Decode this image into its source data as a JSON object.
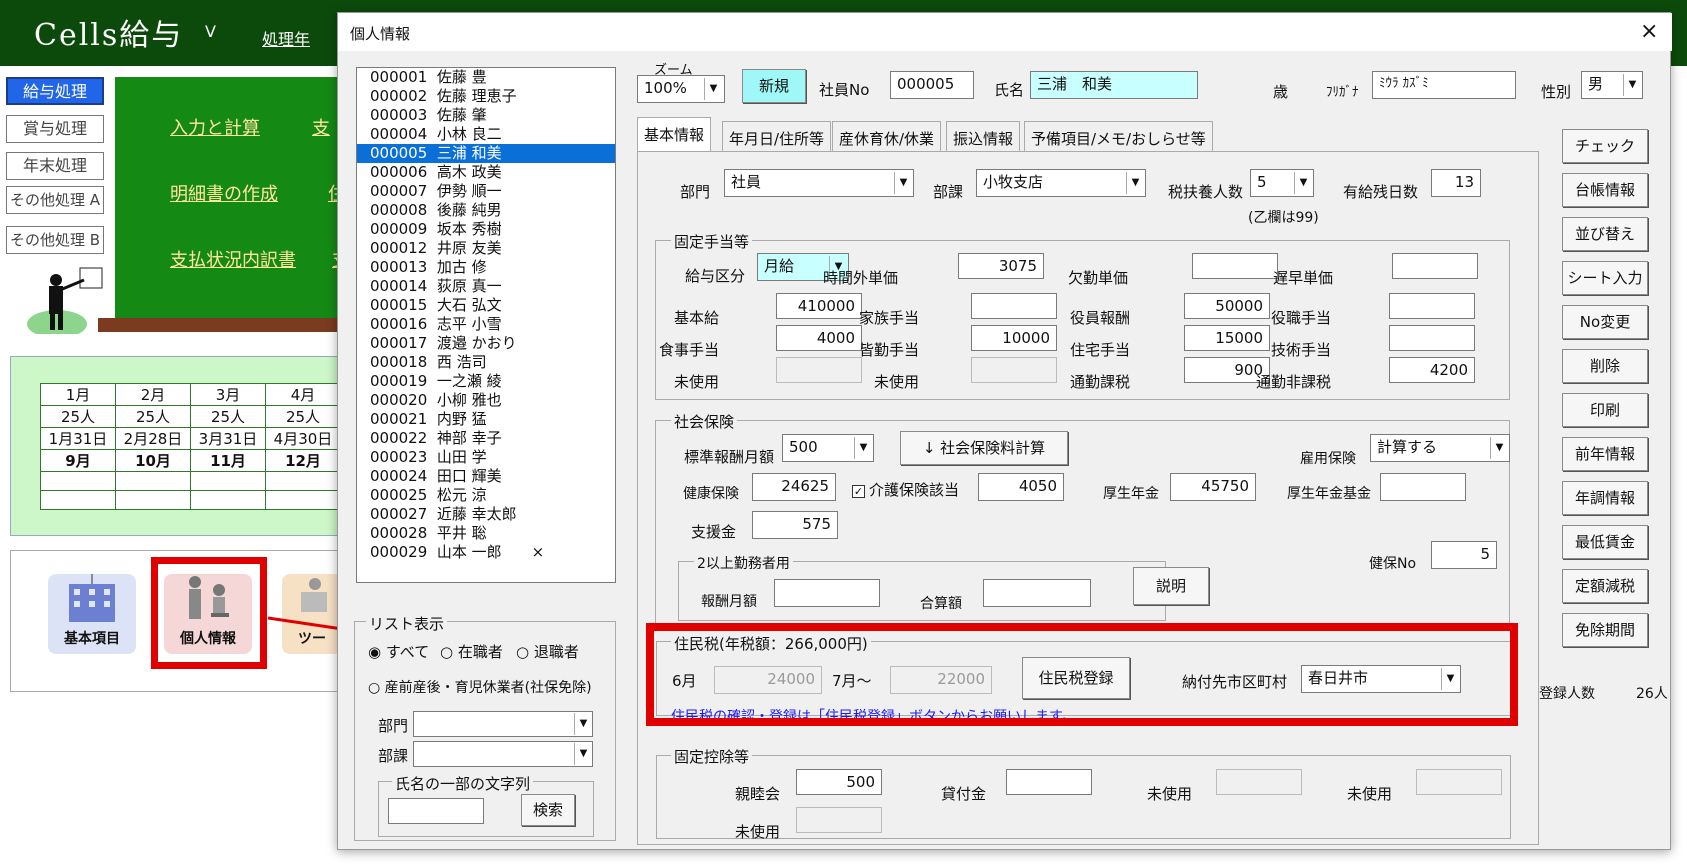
{
  "background": {
    "app_title": "Cells給与",
    "user_initial": "V",
    "processing_year": "処理年",
    "nav": [
      "給与処理",
      "賞与処理",
      "年末処理",
      "その他処理 A",
      "その他処理 B"
    ],
    "links": [
      "入力と計算",
      "明細書の作成",
      "支払状況内訳書",
      "支",
      "住",
      "支"
    ],
    "calendar": {
      "months": [
        "1月",
        "2月",
        "3月",
        "4月"
      ],
      "counts": [
        "25人",
        "25人",
        "25人",
        "25人"
      ],
      "dates": [
        "1月31日",
        "2月28日",
        "3月31日",
        "4月30日"
      ],
      "months2": [
        "9月",
        "10月",
        "11月",
        "12月"
      ]
    },
    "icons": [
      "基本項目",
      "個人情報",
      "ツー"
    ]
  },
  "dialog": {
    "title": "個人情報",
    "close": "×",
    "employees": [
      {
        "no": "000001",
        "name": "佐藤 豊"
      },
      {
        "no": "000002",
        "name": "佐藤 理恵子"
      },
      {
        "no": "000003",
        "name": "佐藤 肇"
      },
      {
        "no": "000004",
        "name": "小林 良二"
      },
      {
        "no": "000005",
        "name": "三浦 和美"
      },
      {
        "no": "000006",
        "name": "高木 政美"
      },
      {
        "no": "000007",
        "name": "伊勢 順一"
      },
      {
        "no": "000008",
        "name": "後藤 純男"
      },
      {
        "no": "000009",
        "name": "坂本 秀樹"
      },
      {
        "no": "000012",
        "name": "井原 友美"
      },
      {
        "no": "000013",
        "name": "加古 修"
      },
      {
        "no": "000014",
        "name": "荻原 真一"
      },
      {
        "no": "000015",
        "name": "大石 弘文"
      },
      {
        "no": "000016",
        "name": "志平 小雪"
      },
      {
        "no": "000017",
        "name": "渡邉 かおり"
      },
      {
        "no": "000018",
        "name": "西 浩司"
      },
      {
        "no": "000019",
        "name": "一之瀬 綾"
      },
      {
        "no": "000020",
        "name": "小柳 雅也"
      },
      {
        "no": "000021",
        "name": "内野 猛"
      },
      {
        "no": "000022",
        "name": "神部 幸子"
      },
      {
        "no": "000023",
        "name": "山田 学"
      },
      {
        "no": "000024",
        "name": "田口 輝美"
      },
      {
        "no": "000025",
        "name": "松元 涼"
      },
      {
        "no": "000027",
        "name": "近藤 幸太郎"
      },
      {
        "no": "000028",
        "name": "平井 聡"
      },
      {
        "no": "000029",
        "name": "山本 一郎"
      }
    ],
    "selected_row": 4,
    "list_mark": "×",
    "list_display": {
      "title": "リスト表示",
      "radio_all": "すべて",
      "radio_active": "在職者",
      "radio_retired": "退職者",
      "radio_leave": "産前産後・育児休業者(社保免除)"
    },
    "filter": {
      "dept_label": "部門",
      "section_label": "部課",
      "name_search_title": "氏名の一部の文字列",
      "search_btn": "検索"
    },
    "header": {
      "zoom_label": "ズーム",
      "zoom": "100%",
      "new_btn": "新規",
      "empno_label": "社員No",
      "empno": "000005",
      "name_label": "氏名",
      "name": "三浦　和美",
      "age_label": "歳",
      "kana_label": "ﾌﾘｶﾞﾅ",
      "kana": "ﾐｳﾗ ｶｽﾞﾐ",
      "gender_label": "性別",
      "gender": "男"
    },
    "tabs": [
      "基本情報",
      "年月日/住所等",
      "産休育休/休業",
      "振込情報",
      "予備項目/メモ/おしらせ等"
    ],
    "basic": {
      "dept_label": "部門",
      "dept": "社員",
      "section_label": "部課",
      "section": "小牧支店",
      "dep_label": "税扶養人数",
      "dep": "5",
      "otsu_note": "(乙欄は99)",
      "leave_label": "有給残日数",
      "leave": "13"
    },
    "fixed_allow": {
      "title": "固定手当等",
      "pay_type_label": "給与区分",
      "pay_type": "月給",
      "rows": [
        {
          "label": "時間外単価",
          "value": "3075"
        },
        {
          "label": "欠勤単価",
          "value": ""
        },
        {
          "label": "遅早単価",
          "value": ""
        },
        {
          "label": "基本給",
          "value": "410000"
        },
        {
          "label": "家族手当",
          "value": ""
        },
        {
          "label": "役員報酬",
          "value": "50000"
        },
        {
          "label": "役職手当",
          "value": ""
        },
        {
          "label": "食事手当",
          "value": "4000"
        },
        {
          "label": "皆勤手当",
          "value": "10000"
        },
        {
          "label": "住宅手当",
          "value": "15000"
        },
        {
          "label": "技術手当",
          "value": ""
        },
        {
          "label": "未使用",
          "value": ""
        },
        {
          "label": "未使用",
          "value": ""
        },
        {
          "label": "通勤課税",
          "value": "900"
        },
        {
          "label": "通勤非課税",
          "value": "4200"
        }
      ]
    },
    "social": {
      "title": "社会保険",
      "std_label": "標準報酬月額",
      "std": "500",
      "calc_btn": "↓  社会保険料計算",
      "emp_ins_label": "雇用保険",
      "emp_ins": "計算する",
      "health_label": "健康保険",
      "health": "24625",
      "care_check": "✓",
      "care_label": "介護保険該当",
      "care": "4050",
      "pension_label": "厚生年金",
      "pension": "45750",
      "fund_label": "厚生年金基金",
      "fund": "",
      "support_label": "支援金",
      "support": "575",
      "kenpo_label": "健保No",
      "kenpo": "5",
      "multi_title": "2以上勤務者用",
      "multi_month_label": "報酬月額",
      "multi_total_label": "合算額",
      "explain_btn": "説明"
    },
    "resident": {
      "title": "住民税(年税額：266,000円)",
      "june_label": "6月",
      "june": "24000",
      "july_label": "7月～",
      "july": "22000",
      "reg_btn": "住民税登録",
      "city_label": "納付先市区町村",
      "city": "春日井市",
      "note": "住民税の確認・登録は「住民税登録」ボタンからお願いします。"
    },
    "deduct": {
      "title": "固定控除等",
      "rows": [
        {
          "label": "親睦会",
          "value": "500"
        },
        {
          "label": "貸付金",
          "value": ""
        },
        {
          "label": "未使用",
          "value": ""
        },
        {
          "label": "未使用",
          "value": ""
        },
        {
          "label": "未使用",
          "value": ""
        }
      ]
    },
    "side_buttons": [
      "チェック",
      "台帳情報",
      "並び替え",
      "シート入力",
      "No変更",
      "削除",
      "印刷",
      "前年情報",
      "年調情報",
      "最低賃金",
      "定額減税",
      "免除期間"
    ],
    "count_label": "登録人数",
    "count": "26人"
  },
  "colors": {
    "green_header": "#0c4a0c",
    "highlight": "#e00000",
    "selected": "#0a6fd6",
    "name_field": "#c8ffff"
  }
}
